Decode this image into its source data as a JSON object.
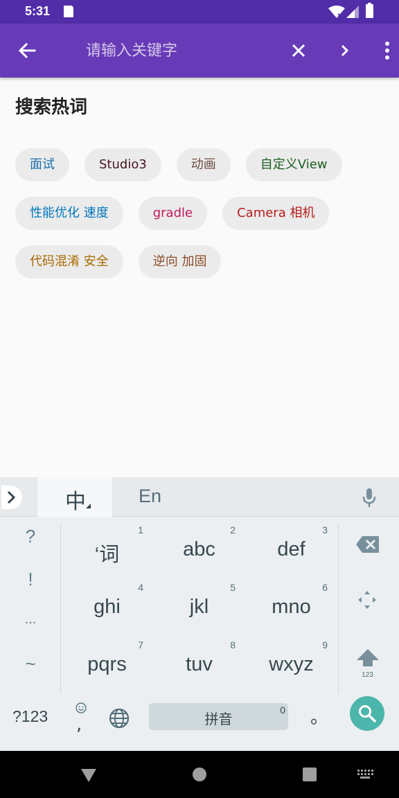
{
  "status_bar": {
    "time": "5:31"
  },
  "toolbar": {
    "search_placeholder": "请输入关键字"
  },
  "hot_words": {
    "title": "搜索热词",
    "tags": [
      {
        "label": "面试",
        "color": "#1a6fa8"
      },
      {
        "label": "Studio3",
        "color": "#4a1420"
      },
      {
        "label": "动画",
        "color": "#6d4c41"
      },
      {
        "label": "自定义View",
        "color": "#1b5e20"
      },
      {
        "label": "性能优化 速度",
        "color": "#0277bd"
      },
      {
        "label": "gradle",
        "color": "#c2185b"
      },
      {
        "label": "Camera 相机",
        "color": "#b71c1c"
      },
      {
        "label": "代码混淆 安全",
        "color": "#a86a00"
      },
      {
        "label": "逆向 加固",
        "color": "#8d4b2a"
      }
    ]
  },
  "keyboard": {
    "mode_zh": "中",
    "mode_en": "En",
    "side_keys": [
      "?",
      "!",
      "...",
      "~"
    ],
    "keys": [
      {
        "label": "‘词",
        "num": "1"
      },
      {
        "label": "abc",
        "num": "2"
      },
      {
        "label": "def",
        "num": "3"
      },
      {
        "label": "ghi",
        "num": "4"
      },
      {
        "label": "jkl",
        "num": "5"
      },
      {
        "label": "mno",
        "num": "6"
      },
      {
        "label": "pqrs",
        "num": "7"
      },
      {
        "label": "tuv",
        "num": "8"
      },
      {
        "label": "wxyz",
        "num": "9"
      }
    ],
    "shift_sub": "123",
    "symbols_label": "?123",
    "comma": ",",
    "space_label": "拼音",
    "space_num": "0",
    "period": "。"
  },
  "colors": {
    "status_bar": "#512da8",
    "toolbar": "#673ab7",
    "tag_bg": "#ebebeb",
    "search_key": "#4db6ac"
  }
}
